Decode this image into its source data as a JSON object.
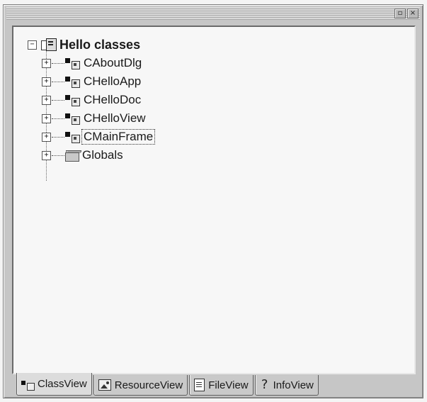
{
  "window": {
    "buttons": [
      "restore",
      "close"
    ]
  },
  "tree": {
    "root": {
      "label": "Hello classes",
      "expander": "−",
      "icon": "classes-root-icon"
    },
    "items": [
      {
        "label": "CAboutDlg",
        "expander": "+",
        "icon": "class-icon"
      },
      {
        "label": "CHelloApp",
        "expander": "+",
        "icon": "class-icon"
      },
      {
        "label": "CHelloDoc",
        "expander": "+",
        "icon": "class-icon"
      },
      {
        "label": "CHelloView",
        "expander": "+",
        "icon": "class-icon"
      },
      {
        "label": "CMainFrame",
        "expander": "+",
        "icon": "class-icon",
        "selected": true
      },
      {
        "label": "Globals",
        "expander": "+",
        "icon": "folder-icon"
      }
    ]
  },
  "tabs": [
    {
      "label": "ClassView",
      "icon": "class-icon",
      "active": true
    },
    {
      "label": "ResourceView",
      "icon": "resource-icon"
    },
    {
      "label": "FileView",
      "icon": "file-icon"
    },
    {
      "label": "InfoView",
      "icon": "help-icon",
      "glyph": "?"
    }
  ]
}
